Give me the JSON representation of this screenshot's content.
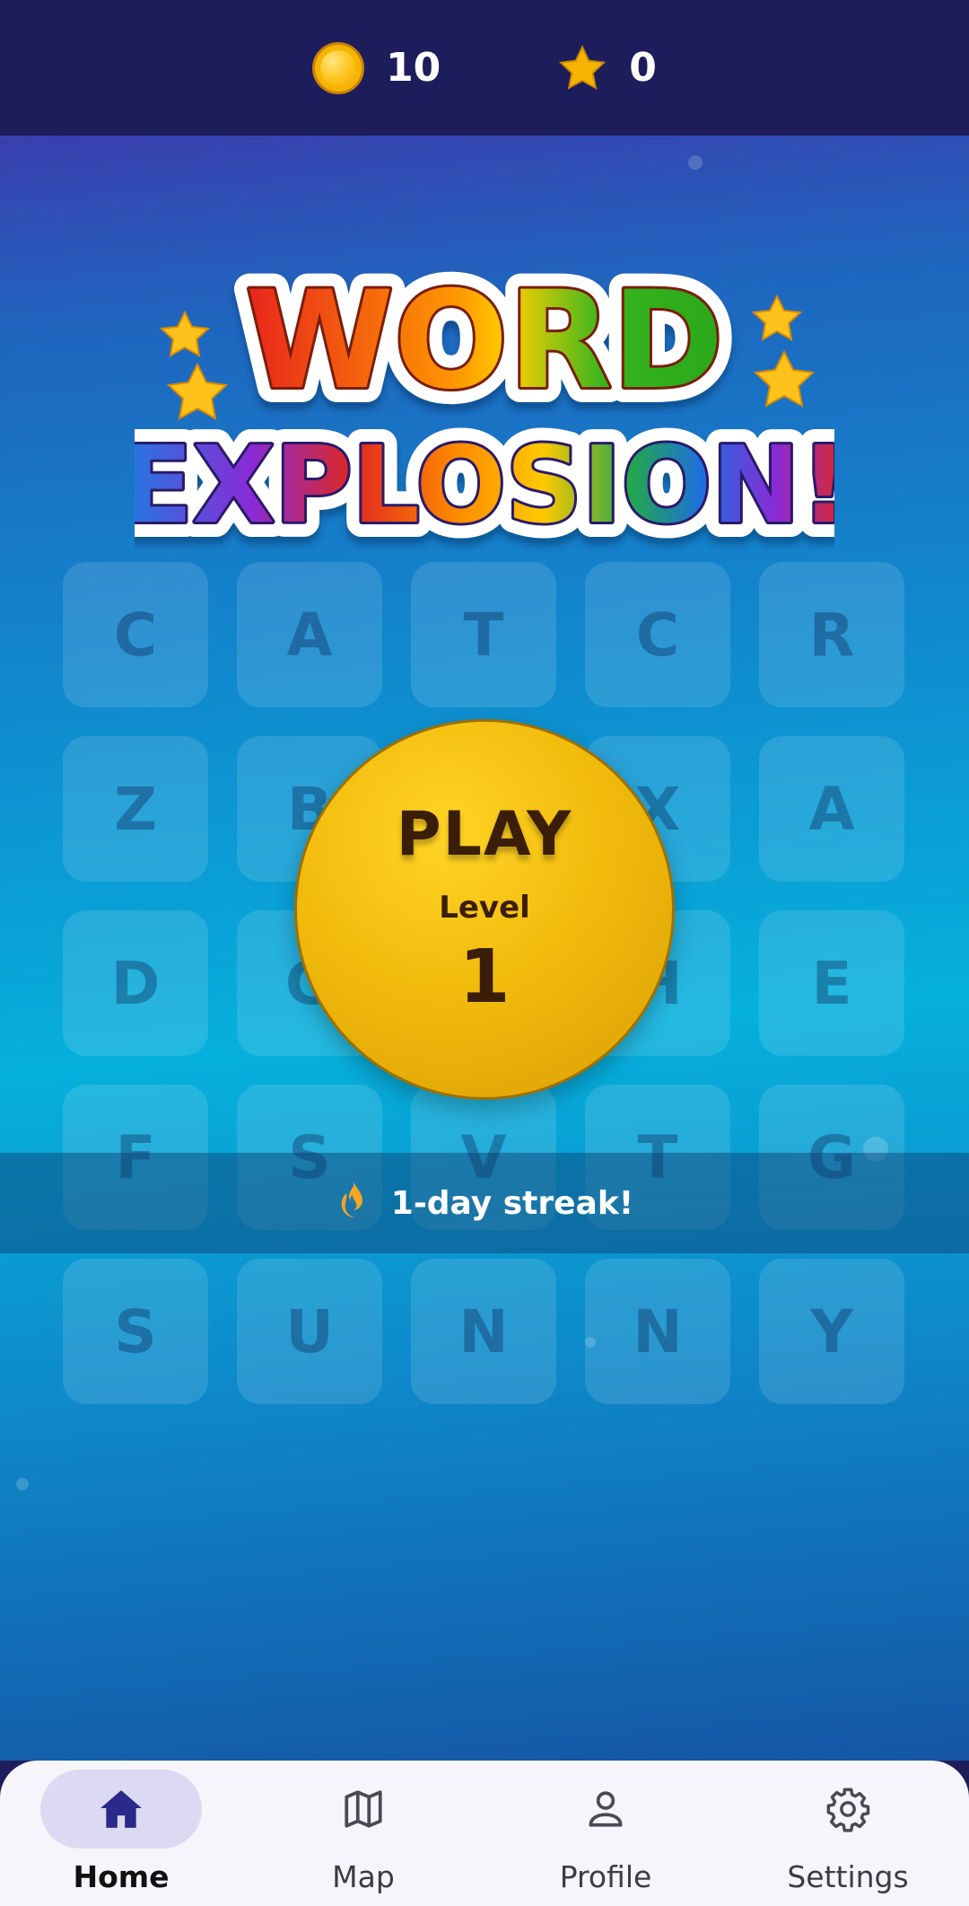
{
  "topbar": {
    "coins": {
      "icon": "coin-icon",
      "value": "10"
    },
    "stars": {
      "icon": "star-icon",
      "value": "0"
    }
  },
  "logo": {
    "line1": "WORD",
    "line2": "EXPLOSION!"
  },
  "grid": {
    "rows": [
      [
        "C",
        "A",
        "T",
        "C",
        "R"
      ],
      [
        "Z",
        "B",
        "",
        "X",
        "A"
      ],
      [
        "D",
        "G",
        "",
        "H",
        "E"
      ],
      [
        "F",
        "S",
        "V",
        "T",
        "G"
      ],
      [
        "S",
        "U",
        "N",
        "N",
        "Y"
      ]
    ]
  },
  "play": {
    "label": "PLAY",
    "level_label": "Level",
    "level_number": "1"
  },
  "streak": {
    "icon": "flame-icon",
    "text": "1-day streak!"
  },
  "nav": {
    "items": [
      {
        "label": "Home",
        "icon": "home-icon",
        "active": true
      },
      {
        "label": "Map",
        "icon": "map-icon",
        "active": false
      },
      {
        "label": "Profile",
        "icon": "profile-icon",
        "active": false
      },
      {
        "label": "Settings",
        "icon": "settings-icon",
        "active": false
      }
    ]
  },
  "colors": {
    "topbar": "#1e1d5c",
    "play_button": "#f2bb0c",
    "nav_active_pill": "#dcdaf2",
    "nav_active_icon": "#2a2a8a"
  }
}
